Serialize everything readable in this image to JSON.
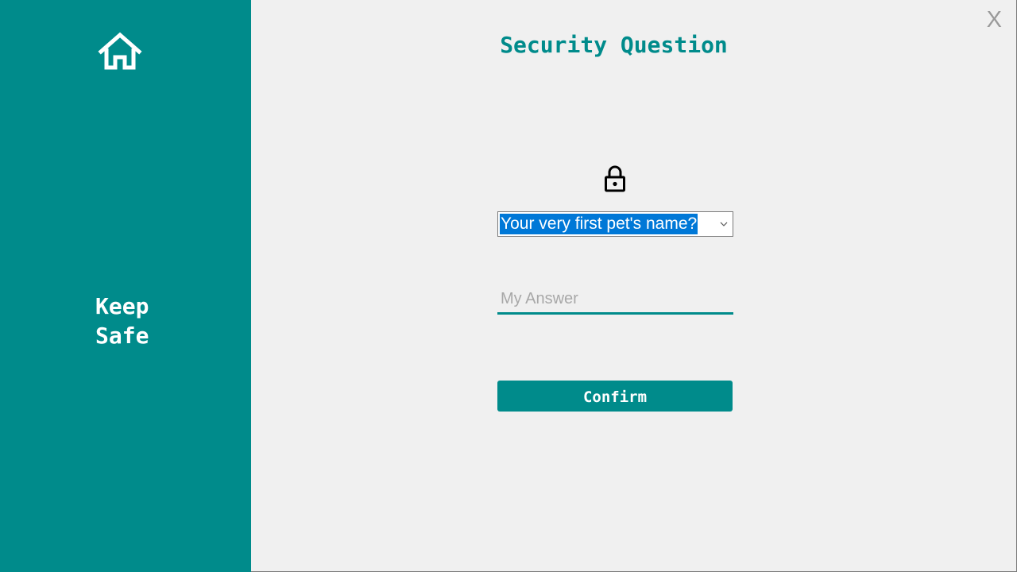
{
  "sidebar": {
    "home_icon": "home-icon",
    "brand_line1": "Keep",
    "brand_line2": "Safe",
    "background": "#008b8b"
  },
  "window": {
    "close_label": "X"
  },
  "main": {
    "title": "Security Question",
    "lock_icon": "lock-icon",
    "question_select": {
      "selected": "Your very first pet's name?"
    },
    "answer_input": {
      "value": "",
      "placeholder": "My Answer"
    },
    "confirm_label": "Confirm"
  },
  "colors": {
    "accent": "#008b8b",
    "background": "#f0f0f0",
    "selection": "#0078d7"
  }
}
